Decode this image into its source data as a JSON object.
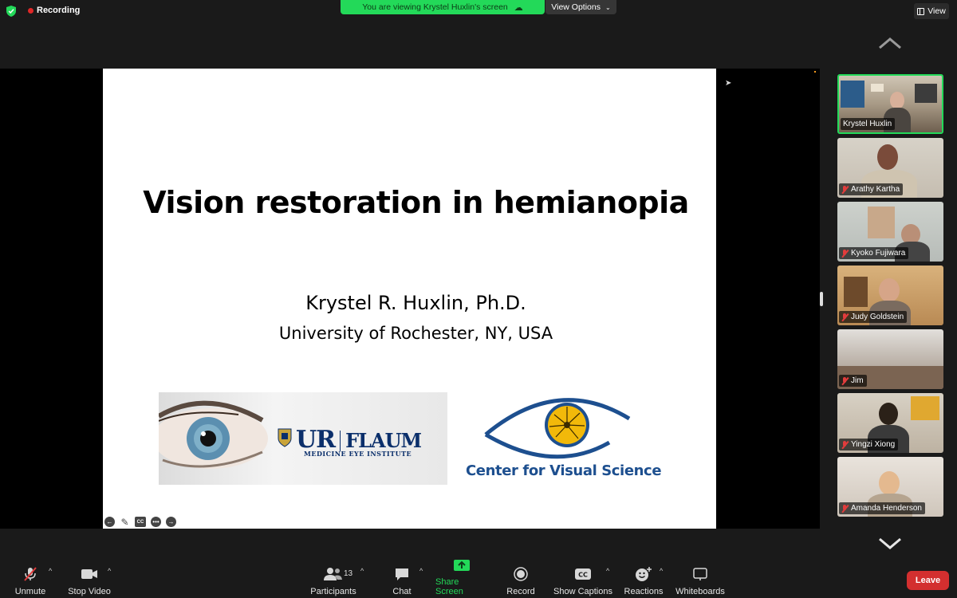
{
  "topbar": {
    "recording_label": "Recording",
    "viewing_banner": "You are viewing Krystel Huxlin's screen",
    "view_options_label": "View Options",
    "view_button_label": "View"
  },
  "slide": {
    "title": "Vision restoration in hemianopia",
    "author": "Krystel R. Huxlin, Ph.D.",
    "institution": "University of Rochester, NY, USA",
    "logo_ur_main_1": "UR",
    "logo_ur_main_2": "FLAUM",
    "logo_ur_sub": "MEDICINE   EYE INSTITUTE",
    "logo_cvs": "Center for Visual Science",
    "controls": [
      "back",
      "pen",
      "cc",
      "more",
      "next"
    ]
  },
  "participants": [
    {
      "name": "Krystel Huxlin",
      "muted": false,
      "active": true
    },
    {
      "name": "Arathy Kartha",
      "muted": true,
      "active": false
    },
    {
      "name": "Kyoko Fujiwara",
      "muted": true,
      "active": false
    },
    {
      "name": "Judy Goldstein",
      "muted": true,
      "active": false
    },
    {
      "name": "Jim",
      "muted": true,
      "active": false
    },
    {
      "name": "Yingzi Xiong",
      "muted": true,
      "active": false
    },
    {
      "name": "Amanda Henderson",
      "muted": true,
      "active": false
    }
  ],
  "toolbar": {
    "unmute": "Unmute",
    "stop_video": "Stop Video",
    "participants": "Participants",
    "participant_count": "13",
    "chat": "Chat",
    "share_screen": "Share Screen",
    "record": "Record",
    "show_captions": "Show Captions",
    "reactions": "Reactions",
    "whiteboards": "Whiteboards",
    "leave": "Leave"
  },
  "colors": {
    "accent_green": "#23d959",
    "leave_red": "#d32f2f",
    "cvs_blue": "#1d4f8f",
    "ur_blue": "#0b2f6b"
  }
}
